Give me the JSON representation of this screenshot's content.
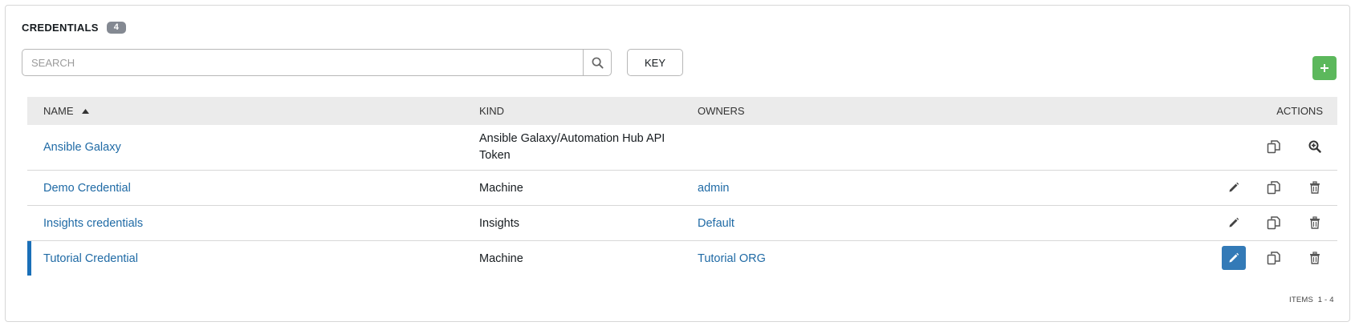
{
  "header": {
    "title": "CREDENTIALS",
    "count": "4"
  },
  "search": {
    "placeholder": "SEARCH",
    "key_label": "KEY"
  },
  "add_label": "+",
  "table": {
    "columns": {
      "name": "NAME",
      "kind": "KIND",
      "owners": "OWNERS",
      "actions": "ACTIONS"
    },
    "sort": {
      "column": "name",
      "direction": "ascending"
    },
    "rows": [
      {
        "name": "Ansible Galaxy",
        "kind": "Ansible Galaxy/Automation Hub API Token",
        "owners": "",
        "actions": [
          "copy",
          "view"
        ]
      },
      {
        "name": "Demo Credential",
        "kind": "Machine",
        "owners": "admin",
        "actions": [
          "edit",
          "copy",
          "delete"
        ]
      },
      {
        "name": "Insights credentials",
        "kind": "Insights",
        "owners": "Default",
        "actions": [
          "edit",
          "copy",
          "delete"
        ]
      },
      {
        "name": "Tutorial Credential",
        "kind": "Machine",
        "owners": "Tutorial ORG",
        "actions": [
          "edit",
          "copy",
          "delete"
        ],
        "selected": true
      }
    ]
  },
  "pagination": {
    "label": "ITEMS",
    "range": "1 - 4"
  },
  "icons": {
    "search": "search-icon",
    "add": "plus-icon",
    "sort": "sort-up-icon",
    "edit": "pencil-icon",
    "copy": "copy-icon",
    "view": "zoom-in-icon",
    "delete": "trash-icon"
  },
  "colors": {
    "link": "#1f6aa5",
    "add_button": "#5cb85c",
    "edit_active": "#337ab7",
    "selected_bar": "#1a6fb8",
    "header_bg": "#ebebeb",
    "badge": "#848992"
  }
}
